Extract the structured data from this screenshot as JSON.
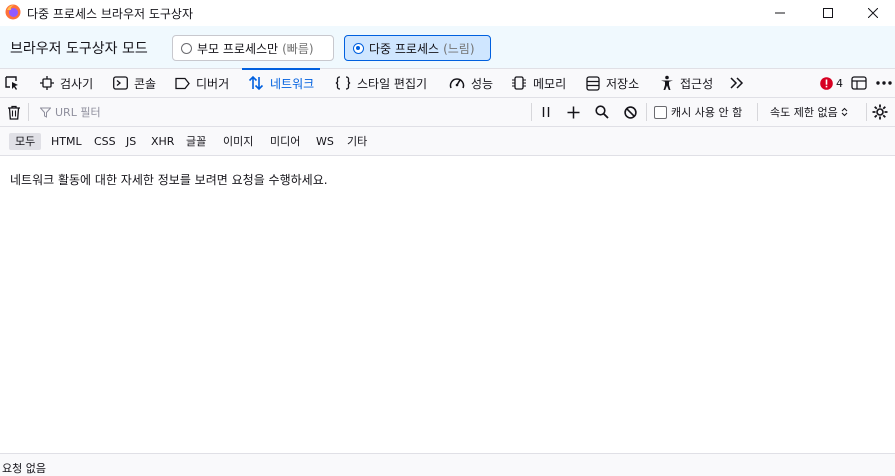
{
  "window": {
    "title": "다중 프로세스 브라우저 도구상자"
  },
  "mode_bar": {
    "label": "브라우저 도구상자 모드",
    "parent_option": {
      "label": "부모 프로세스만",
      "note": "(빠름)"
    },
    "multi_option": {
      "label": "다중 프로세스",
      "note": "(느림)"
    },
    "selected": "multi"
  },
  "tabs": [
    {
      "label": "검사기",
      "icon": "inspector-icon"
    },
    {
      "label": "콘솔",
      "icon": "console-icon"
    },
    {
      "label": "디버거",
      "icon": "debugger-icon"
    },
    {
      "label": "네트워크",
      "icon": "network-icon",
      "selected": true
    },
    {
      "label": "스타일 편집기",
      "icon": "style-editor-icon"
    },
    {
      "label": "성능",
      "icon": "performance-icon"
    },
    {
      "label": "메모리",
      "icon": "memory-icon"
    },
    {
      "label": "저장소",
      "icon": "storage-icon"
    },
    {
      "label": "접근성",
      "icon": "accessibility-icon"
    }
  ],
  "error_count": "4",
  "toolbar": {
    "url_filter_placeholder": "URL 필터",
    "disable_cache_label": "캐시 사용 안 함",
    "throttling_label": "속도 제한 없음"
  },
  "request_types": [
    "모두",
    "HTML",
    "CSS",
    "JS",
    "XHR",
    "글꼴",
    "이미지",
    "미디어",
    "WS",
    "기타"
  ],
  "empty_message": "네트워크 활동에 대한 자세한 정보를 보려면 요청을 수행하세요.",
  "status": "요청 없음",
  "colors": {
    "accent": "#0060df",
    "mode_bar_bg": "#f0f9fe",
    "error_red": "#d70022"
  }
}
